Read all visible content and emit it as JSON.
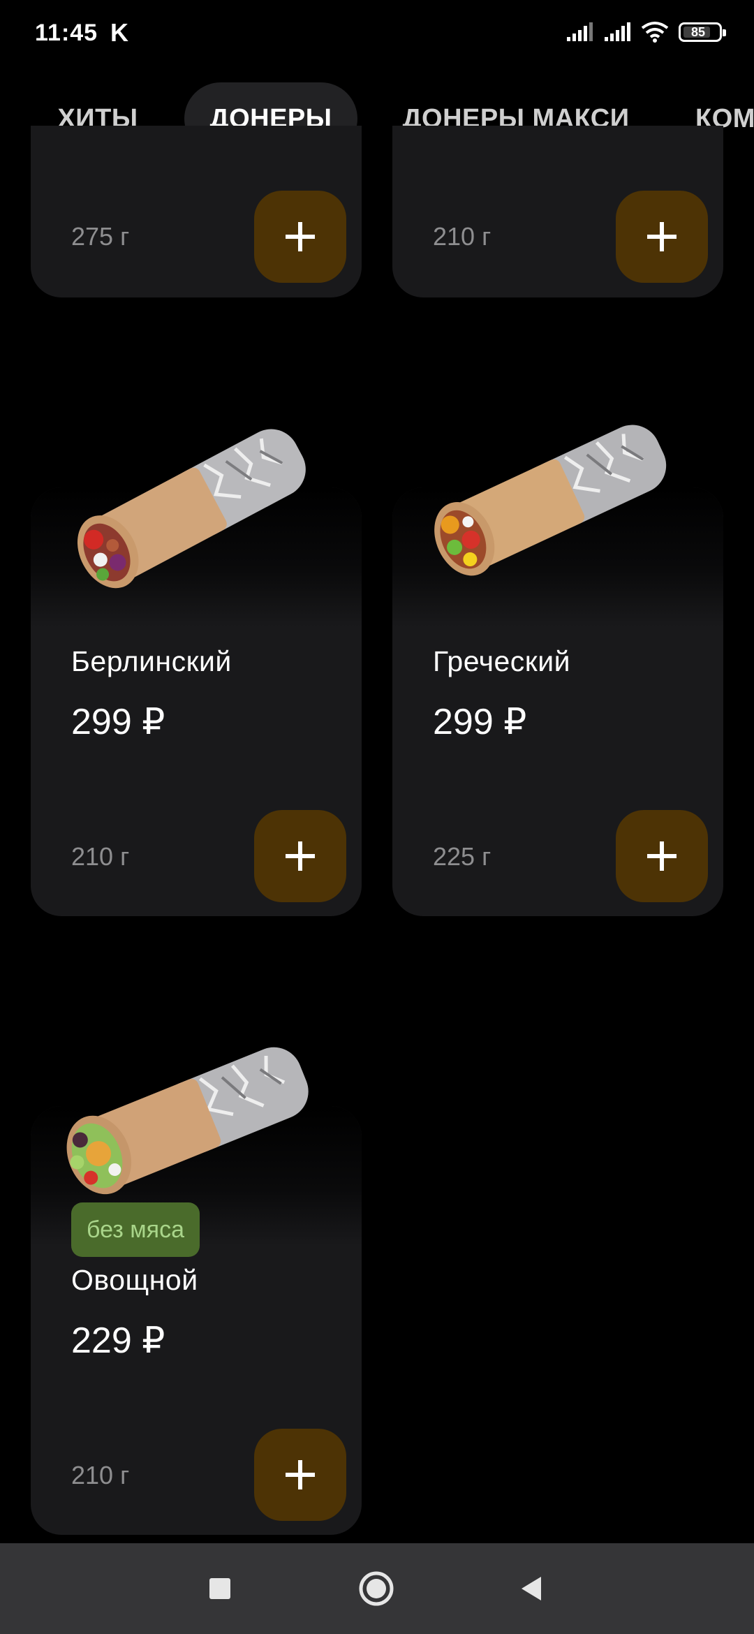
{
  "status_bar": {
    "time": "11:45",
    "carrier_badge": "K",
    "battery": "85"
  },
  "tabs": [
    {
      "label": "ХИТЫ"
    },
    {
      "label": "ДОНЕРЫ"
    },
    {
      "label": "ДОНЕРЫ МАКСИ"
    },
    {
      "label": "КОМ"
    }
  ],
  "partial_products": [
    {
      "weight": "275 г"
    },
    {
      "weight": "210 г"
    }
  ],
  "products": [
    {
      "name": "Берлинский",
      "price": "299 ₽",
      "weight": "210 г"
    },
    {
      "name": "Греческий",
      "price": "299 ₽",
      "weight": "225 г"
    },
    {
      "name": "Овощной",
      "price": "229 ₽",
      "weight": "210 г",
      "badge": "без мяса"
    }
  ],
  "colors": {
    "background": "#000000",
    "card": "#19191b",
    "add_button": "#4d3305",
    "badge_bg": "#4a6b2b",
    "badge_text": "#a9d58a",
    "navbar": "#353537"
  },
  "icons": [
    "signal-icon",
    "wifi-icon",
    "battery-icon",
    "plus-icon",
    "square-nav-icon",
    "circle-nav-icon",
    "back-nav-icon"
  ]
}
